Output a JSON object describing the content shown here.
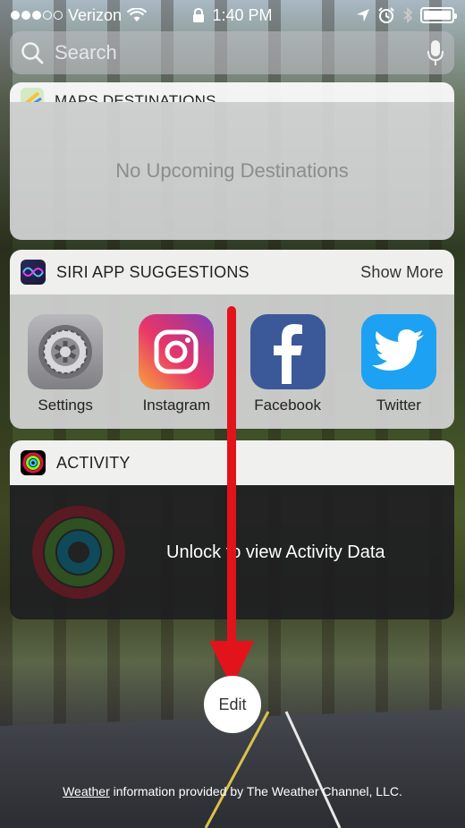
{
  "status_bar": {
    "carrier": "Verizon",
    "signal_filled": 3,
    "signal_total": 5,
    "time": "1:40 PM"
  },
  "search": {
    "placeholder": "Search"
  },
  "widgets": {
    "maps": {
      "title": "MAPS DESTINATIONS",
      "message": "No Upcoming Destinations"
    },
    "siri": {
      "title": "SIRI APP SUGGESTIONS",
      "more_label": "Show More",
      "apps": [
        {
          "name": "Settings",
          "icon": "settings-icon"
        },
        {
          "name": "Instagram",
          "icon": "instagram-icon"
        },
        {
          "name": "Facebook",
          "icon": "facebook-icon"
        },
        {
          "name": "Twitter",
          "icon": "twitter-icon"
        }
      ]
    },
    "activity": {
      "title": "ACTIVITY",
      "message": "Unlock to view Activity Data"
    }
  },
  "edit_label": "Edit",
  "footer": {
    "link": "Weather",
    "text": " information provided by The Weather Channel, LLC."
  },
  "colors": {
    "arrow": "#e2141b",
    "facebook": "#3b5998",
    "twitter": "#1da1f2"
  }
}
